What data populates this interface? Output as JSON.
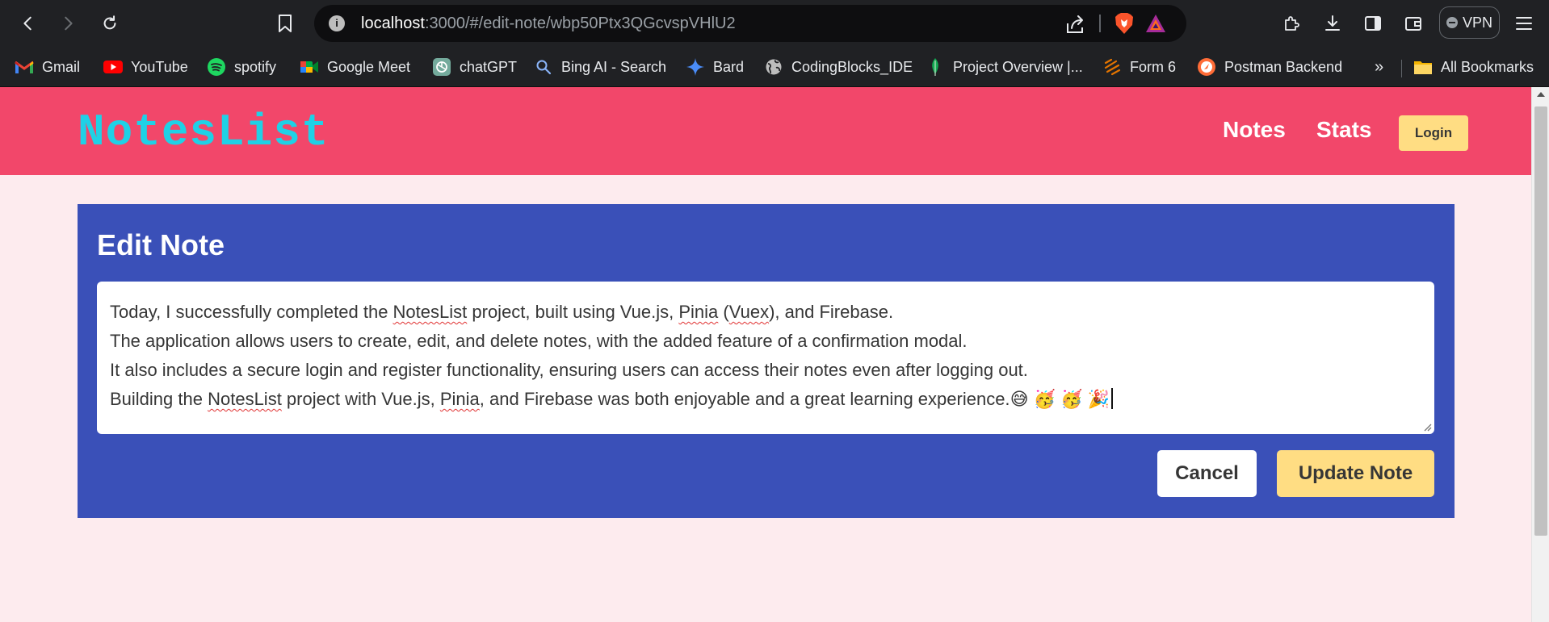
{
  "browser": {
    "url_host": "localhost",
    "url_path": ":3000/#/edit-note/wbp50Ptx3QGcvspVHlU2",
    "vpn_label": "VPN",
    "bookmarks": [
      {
        "label": "Gmail",
        "icon": "gmail-icon"
      },
      {
        "label": "YouTube",
        "icon": "youtube-icon"
      },
      {
        "label": "spotify",
        "icon": "spotify-icon"
      },
      {
        "label": "Google Meet",
        "icon": "google-meet-icon"
      },
      {
        "label": "chatGPT",
        "icon": "chatgpt-icon"
      },
      {
        "label": "Bing AI - Search",
        "icon": "search-icon"
      },
      {
        "label": "Bard",
        "icon": "bard-icon"
      },
      {
        "label": "CodingBlocks_IDE",
        "icon": "globe-icon"
      },
      {
        "label": "Project Overview |...",
        "icon": "mongodb-leaf-icon"
      },
      {
        "label": "Form 6",
        "icon": "form-icon"
      },
      {
        "label": "Postman Backend",
        "icon": "postman-icon"
      }
    ],
    "more_label": "»",
    "all_bookmarks_label": "All Bookmarks"
  },
  "app": {
    "brand": "NotesList",
    "nav": {
      "notes": "Notes",
      "stats": "Stats",
      "login": "Login"
    },
    "edit": {
      "title": "Edit Note",
      "lines": [
        {
          "a": "Today, I successfully completed the ",
          "b": "NotesList",
          "c": " project, built using Vue.js, ",
          "d": "Pinia",
          "e": " (",
          "f": "Vuex",
          "g": "), and Firebase."
        },
        {
          "text": "The application allows users to create, edit, and delete notes, with the added feature of a confirmation modal."
        },
        {
          "text": "It also includes a secure login and register functionality, ensuring users can access their notes even after logging out."
        },
        {
          "a": "Building the ",
          "b": "NotesList",
          "c": " project with Vue.js, ",
          "d": "Pinia",
          "e": ", and Firebase was both enjoyable and a great learning experience.",
          "emoji": "😅 🥳 🥳 🎉"
        }
      ],
      "cancel_label": "Cancel",
      "update_label": "Update Note"
    }
  },
  "colors": {
    "nav_bg": "#f2476a",
    "brand_text": "#1fd1e6",
    "card_bg": "#3a50b8",
    "page_bg": "#fdebee",
    "accent_yellow": "#ffdd83"
  }
}
